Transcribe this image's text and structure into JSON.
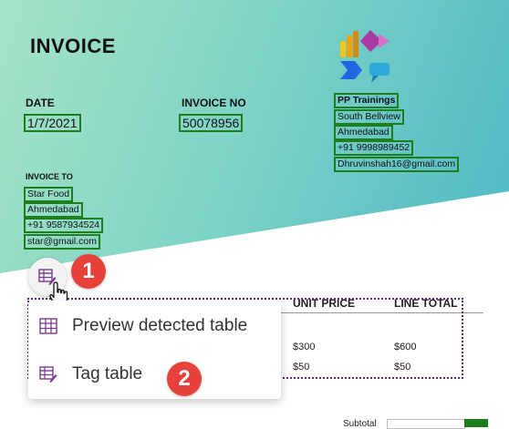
{
  "invoice": {
    "title": "INVOICE",
    "date_label": "DATE",
    "date_value": "1/7/2021",
    "invoice_no_label": "INVOICE NO",
    "invoice_no_value": "50078956",
    "company": {
      "name": "PP Trainings",
      "street": "South Bellview",
      "city": "Ahmedabad",
      "phone": "+91 9998989452",
      "email": "Dhruvinshah16@gmail.com"
    },
    "invoice_to_label": "INVOICE TO",
    "customer": {
      "name": "Star Food",
      "city": "Ahmedabad",
      "phone": "+91 9587934524",
      "email": "star@gmail.com"
    }
  },
  "table": {
    "headers": {
      "unit_price": "UNIT PRICE",
      "line_total": "LINE TOTAL"
    },
    "rows": [
      {
        "unit_price": "$300",
        "line_total": "$600"
      },
      {
        "unit_price": "$50",
        "line_total": "$50"
      }
    ]
  },
  "subtotal_label": "Subtotal",
  "menu": {
    "items": [
      {
        "label": "Preview detected table",
        "icon": "table-grid-icon"
      },
      {
        "label": "Tag table",
        "icon": "table-edit-icon"
      }
    ]
  },
  "callouts": [
    "1",
    "2"
  ],
  "colors": {
    "field_outline": "#1e7e1e",
    "detected_table_outline": "#5b2d6e",
    "callout_badge": "#e8413a",
    "menu_icon": "#7a3b8f"
  }
}
